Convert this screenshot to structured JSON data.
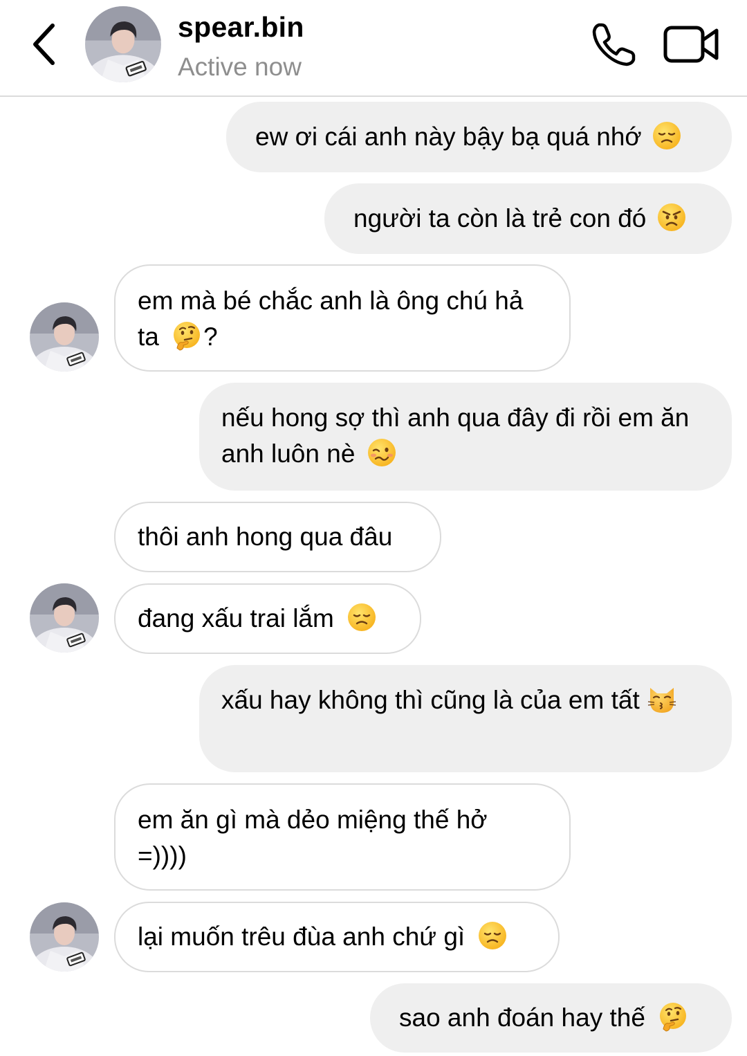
{
  "header": {
    "user_name": "spear.bin",
    "status": "Active now",
    "icons": {
      "back": "chevron-left-icon",
      "call": "phone-icon",
      "video": "video-camera-icon"
    }
  },
  "messages": [
    {
      "direction": "outgoing",
      "text": "ew ơi cái anh này bậy bạ quá nhớ",
      "emoji": "disappointed-face"
    },
    {
      "direction": "outgoing",
      "text": "người ta còn là trẻ con đó",
      "emoji": "angry-face"
    },
    {
      "direction": "incoming",
      "text": "em mà bé chắc anh là ông chú hả ta",
      "emoji": "thinking-face",
      "suffix": "?"
    },
    {
      "direction": "outgoing",
      "text": "nếu hong sợ thì anh qua đây đi rồi em ăn anh luôn nè",
      "emoji": "woozy-face"
    },
    {
      "direction": "incoming",
      "text": "thôi anh hong qua đâu"
    },
    {
      "direction": "incoming",
      "text": "đang xấu trai lắm",
      "emoji": "disappointed-face"
    },
    {
      "direction": "outgoing",
      "text": "xấu hay không thì cũng là của em tất",
      "emoji": "kissing-cat"
    },
    {
      "direction": "incoming",
      "text": "em ăn gì mà dẻo miệng thế hở =))))"
    },
    {
      "direction": "incoming",
      "text": "lại muốn trêu đùa anh chứ gì",
      "emoji": "disappointed-face"
    },
    {
      "direction": "outgoing",
      "text": "sao anh đoán hay thế",
      "emoji": "thinking-face"
    }
  ],
  "colors": {
    "outgoing_bubble": "#efefef",
    "incoming_border": "#dbdbdb",
    "status_text": "#8e8e8e"
  }
}
